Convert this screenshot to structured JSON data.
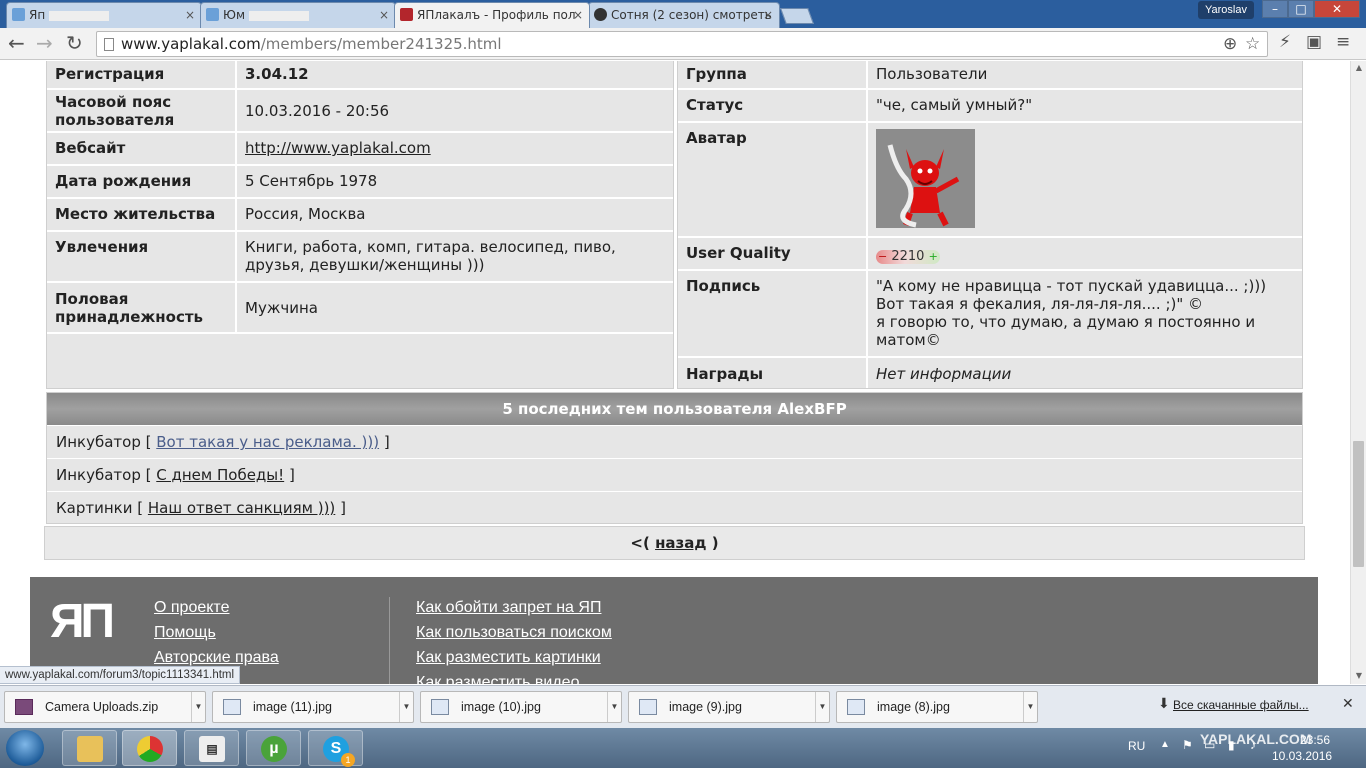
{
  "browser": {
    "tabs": [
      {
        "title": "Яп"
      },
      {
        "title": "Юм"
      },
      {
        "title": "ЯПлакалъ - Профиль пол"
      },
      {
        "title": "Сотня (2 сезон) смотреть"
      }
    ],
    "user": "Yaroslav",
    "url_host": "www.yaplakal.com",
    "url_path": "/members/member241325.html",
    "status_link": "www.yaplakal.com/forum3/topic1113341.html"
  },
  "profile_left": [
    {
      "label": "Регистрация",
      "value": "3.04.12"
    },
    {
      "label": "Часовой пояс пользователя",
      "value": "10.03.2016 - 20:56"
    },
    {
      "label": "Вебсайт",
      "value": "http://www.yaplakal.com"
    },
    {
      "label": "Дата рождения",
      "value": "5 Сентябрь 1978"
    },
    {
      "label": "Место жительства",
      "value": "Россия, Москва"
    },
    {
      "label": "Увлечения",
      "value": "Книги, работа, комп, гитара. велосипед, пиво, друзья, девушки/женщины )))"
    },
    {
      "label": "Половая принадлежность",
      "value": "Мужчина"
    }
  ],
  "profile_right": {
    "group": {
      "label": "Группа",
      "value": "Пользователи"
    },
    "status": {
      "label": "Статус",
      "value": "\"че, самый умный?\""
    },
    "avatar": {
      "label": "Аватар"
    },
    "quality": {
      "label": "User Quality",
      "value": "2210",
      "minus": "−",
      "plus": "+"
    },
    "signature": {
      "label": "Подпись",
      "lines": [
        "\"А кому не нравицца - тот пускай удавицца... ;)))",
        "Вот такая я фекалия, ля-ля-ля-ля.... ;)\" ©",
        "я говорю то, что думаю, а думаю я постоянно и",
        "матом©"
      ]
    },
    "awards": {
      "label": "Награды",
      "value": "Нет информации"
    }
  },
  "topics": {
    "header": "5 последних тем пользователя AlexBFP",
    "items": [
      {
        "section": "Инкубатор",
        "title": "Вот такая у нас реклама. )))"
      },
      {
        "section": "Инкубатор",
        "title": "С днем Победы!"
      },
      {
        "section": "Картинки",
        "title": "Наш ответ санкциям )))"
      }
    ],
    "bracket_open": "[",
    "bracket_close": "]"
  },
  "back": {
    "prefix": "<(",
    "link": "назад",
    "suffix": ")"
  },
  "footer": {
    "logo": "ЯП",
    "col1": [
      "О проекте",
      "Помощь",
      "Авторские права"
    ],
    "col2": [
      "Как обойти запрет на ЯП",
      "Как пользоваться поиском",
      "Как разместить картинки",
      "Как разместить видео"
    ]
  },
  "downloads": {
    "items": [
      "Camera Uploads.zip",
      "image (11).jpg",
      "image (10).jpg",
      "image (9).jpg",
      "image (8).jpg"
    ],
    "all": "Все скачанные файлы..."
  },
  "taskbar": {
    "lang": "RU",
    "time": "23:56",
    "date": "10.03.2016",
    "watermark": "YAPLAKAL.COM",
    "skype_badge": "1"
  }
}
